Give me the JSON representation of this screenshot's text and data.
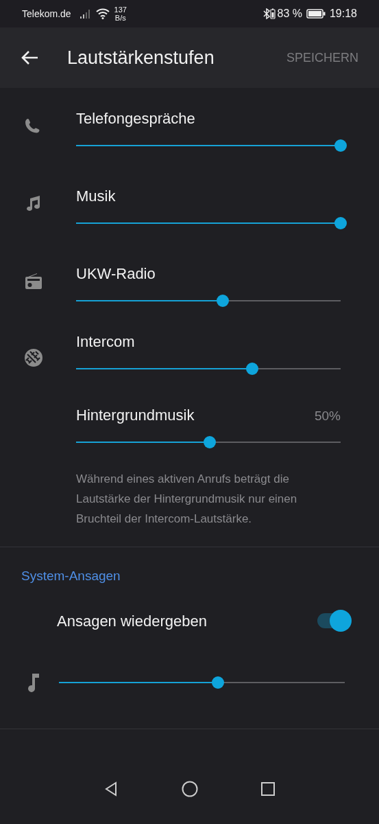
{
  "status_bar": {
    "carrier": "Telekom.de",
    "net_speed_value": "137",
    "net_speed_unit": "B/s",
    "battery_percent": "83 %",
    "time": "19:18"
  },
  "app_bar": {
    "title": "Lautstärkenstufen",
    "action": "SPEICHERN"
  },
  "volume_sliders": [
    {
      "label": "Telefongespräche",
      "level": 1.0
    },
    {
      "label": "Musik",
      "level": 1.0
    },
    {
      "label": "UKW-Radio",
      "level": 0.555
    },
    {
      "label": "Intercom",
      "level": 0.665
    },
    {
      "label": "Hintergrundmusik",
      "reading": "50%",
      "level": 0.505
    }
  ],
  "note": "Während eines aktiven Anrufs beträgt die Lautstärke der Hintergrundmusik nur einen Bruchteil der Intercom-Lautstärke.",
  "system_section": {
    "heading": "System-Ansagen",
    "toggle": {
      "label": "Ansagen wiedergeben",
      "on": true
    },
    "slider": {
      "level": 0.556
    }
  }
}
